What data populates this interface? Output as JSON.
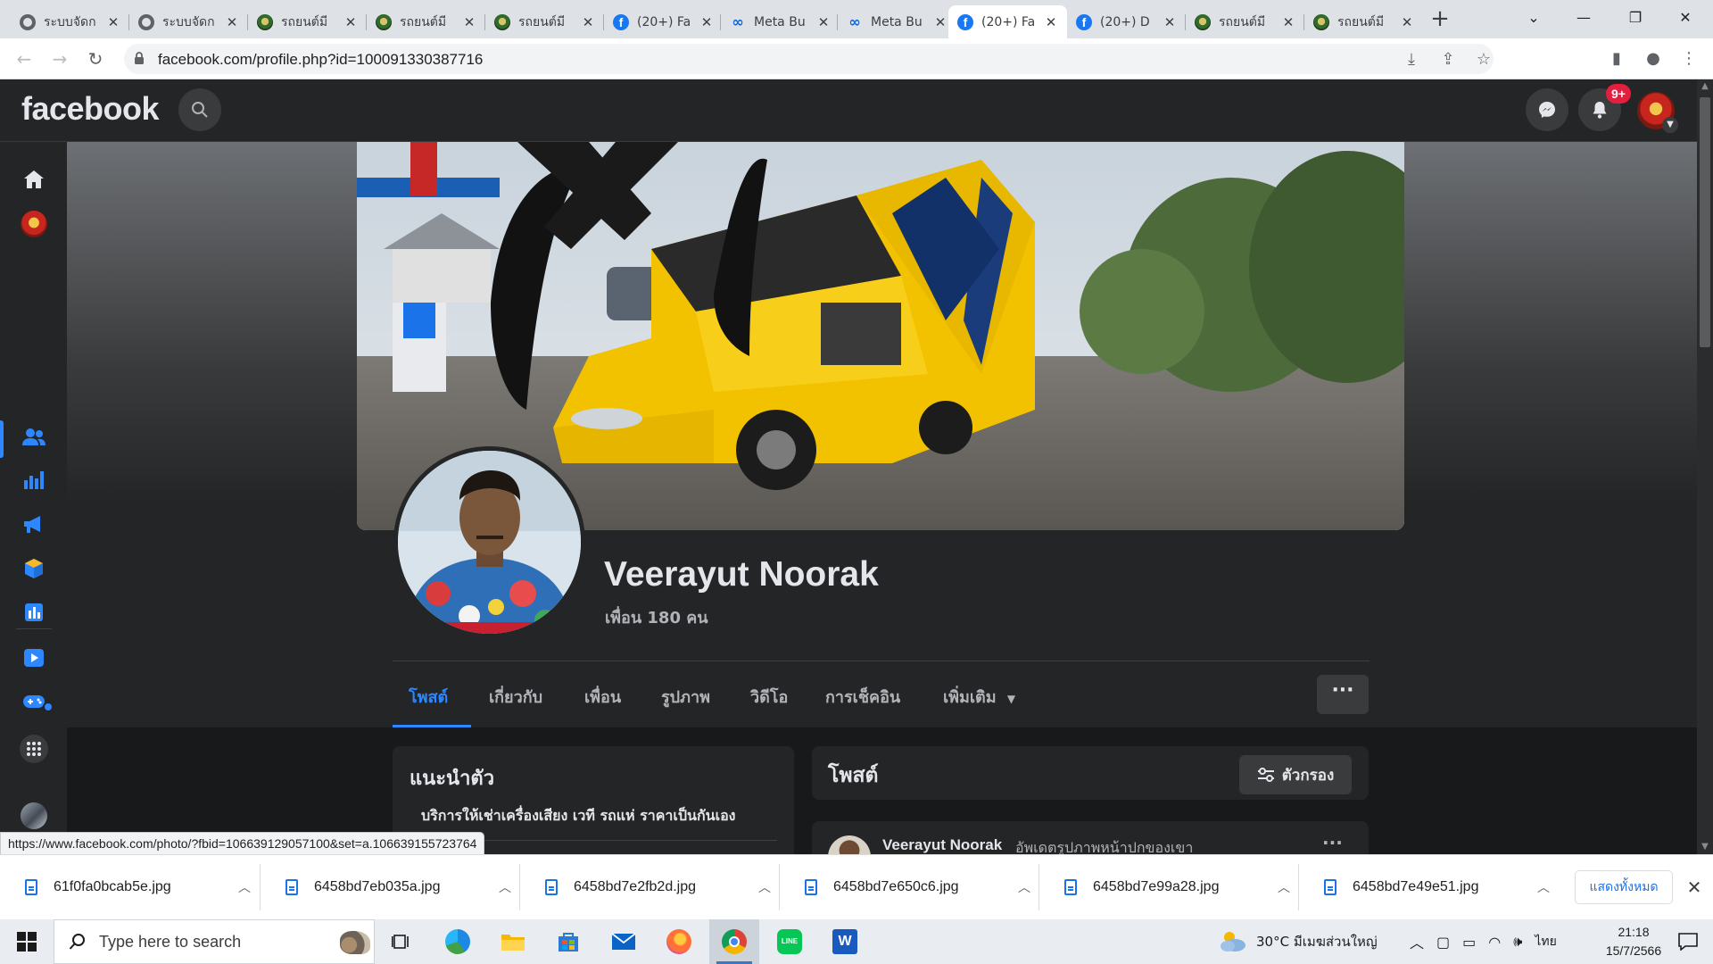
{
  "browser": {
    "tabs": [
      {
        "title": "ระบบจัดก",
        "favicon": "globe-icon"
      },
      {
        "title": "ระบบจัดก",
        "favicon": "globe-icon"
      },
      {
        "title": "รถยนต์มี",
        "favicon": "seal-icon"
      },
      {
        "title": "รถยนต์มี",
        "favicon": "seal-icon"
      },
      {
        "title": "รถยนต์มี",
        "favicon": "seal-icon"
      },
      {
        "title": "(20+) Fa",
        "favicon": "facebook-icon"
      },
      {
        "title": "Meta Bu",
        "favicon": "meta-icon"
      },
      {
        "title": "Meta Bu",
        "favicon": "meta-icon"
      },
      {
        "title": "(20+) Fa",
        "favicon": "facebook-icon",
        "active": true
      },
      {
        "title": "(20+) D",
        "favicon": "facebook-icon"
      },
      {
        "title": "รถยนต์มี",
        "favicon": "seal-icon"
      },
      {
        "title": "รถยนต์มี",
        "favicon": "seal-icon"
      }
    ],
    "new_tab_label": "+",
    "url": "facebook.com/profile.php?id=100091330387716",
    "status_url": "https://www.facebook.com/photo/?fbid=106639129057100&set=a.106639155723764"
  },
  "facebook": {
    "logo": "facebook",
    "notifications_badge": "9+",
    "profile": {
      "name": "Veerayut Noorak",
      "friends": "เพื่อน 180 คน"
    },
    "tabs": [
      "โพสต์",
      "เกี่ยวกับ",
      "เพื่อน",
      "รูปภาพ",
      "วิดีโอ",
      "การเช็คอิน",
      "เพิ่มเติม"
    ],
    "more_dots": "···",
    "intro": {
      "title": "แนะนำตัว",
      "bio": "บริการให้เช่าเครื่องเสียง เวที รถแห่ ราคาเป็นกันเอง"
    },
    "posts": {
      "title": "โพสต์",
      "filter_label": "ตัวกรอง",
      "first_post_author": "Veerayut Noorak",
      "first_post_action": "อัพเดตรูปภาพหน้าปกของเขา"
    }
  },
  "downloads": {
    "files": [
      "61f0fa0bcab5e.jpg",
      "6458bd7eb035a.jpg",
      "6458bd7e2fb2d.jpg",
      "6458bd7e650c6.jpg",
      "6458bd7e99a28.jpg",
      "6458bd7e49e51.jpg"
    ],
    "show_all_label": "แสดงทั้งหมด"
  },
  "taskbar": {
    "search_placeholder": "Type here to search",
    "weather": "30°C  มีเมฆส่วนใหญ่",
    "language": "ไทย",
    "time": "21:18",
    "date": "15/7/2566"
  },
  "colors": {
    "fb_blue": "#2d88ff",
    "fb_dark_bg": "#18191a",
    "fb_card": "#242526",
    "badge_red": "#e41e3f"
  }
}
